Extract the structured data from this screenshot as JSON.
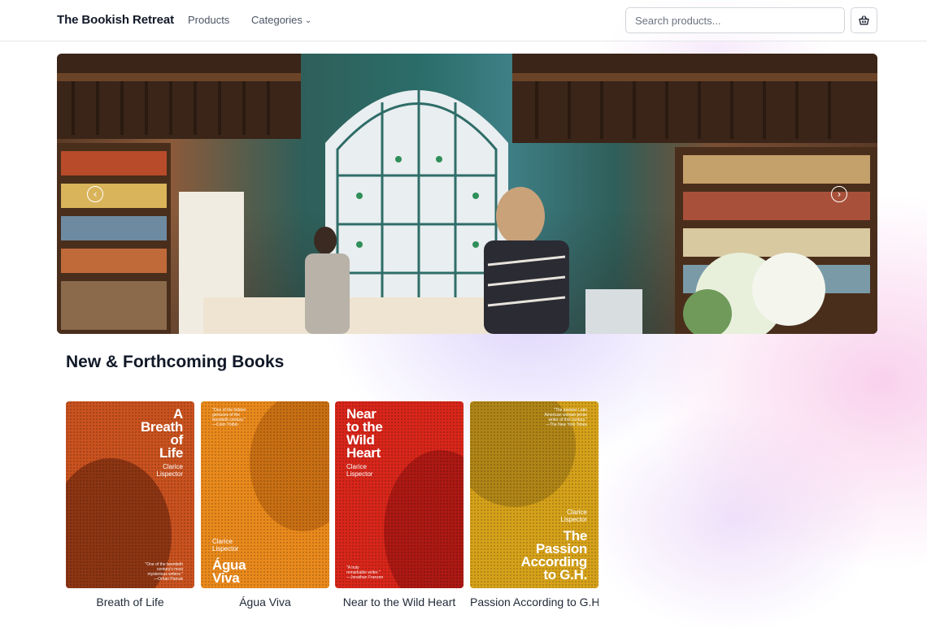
{
  "header": {
    "brand": "The Bookish Retreat",
    "nav": {
      "products": "Products",
      "categories": "Categories"
    },
    "search_placeholder": "Search products...",
    "cart_icon": "basket-icon"
  },
  "hero": {
    "image_alt": "Bookstore interior with stained glass window",
    "prev_icon": "chevron-left-icon",
    "next_icon": "chevron-right-icon"
  },
  "section": {
    "title": "New & Forthcoming Books"
  },
  "books": [
    {
      "label": "Breath of Life",
      "cover_title": "A\nBreath\nof\nLife",
      "cover_author": "Clarice\nLispector",
      "cover_quote": "\"One of the twentieth\ncentury's most\nmysterious writers.\"\n—Orhan Pamuk",
      "color": "#c9521f"
    },
    {
      "label": "Água Viva",
      "cover_title": "Água\nViva",
      "cover_author": "Clarice\nLispector",
      "cover_quote": "\"One of the hidden\ngeniuses of the\ntwentieth century.\"\n—Colm Tóibín",
      "color": "#ea8a1c"
    },
    {
      "label": "Near to the Wild Heart",
      "cover_title": "Near\nto the\nWild\nHeart",
      "cover_author": "Clarice\nLispector",
      "cover_quote": "\"A truly\nremarkable writer.\"\n—Jonathan Franzen",
      "color": "#d8261a"
    },
    {
      "label": "Passion According to G.H.",
      "cover_title": "The\nPassion\nAccording\nto G.H.",
      "cover_author": "Clarice\nLispector",
      "cover_quote": "\"The premier Latin\nAmerican woman prose\nwriter of this century.\"\n—The New York Times",
      "color": "#d6a21a"
    }
  ]
}
